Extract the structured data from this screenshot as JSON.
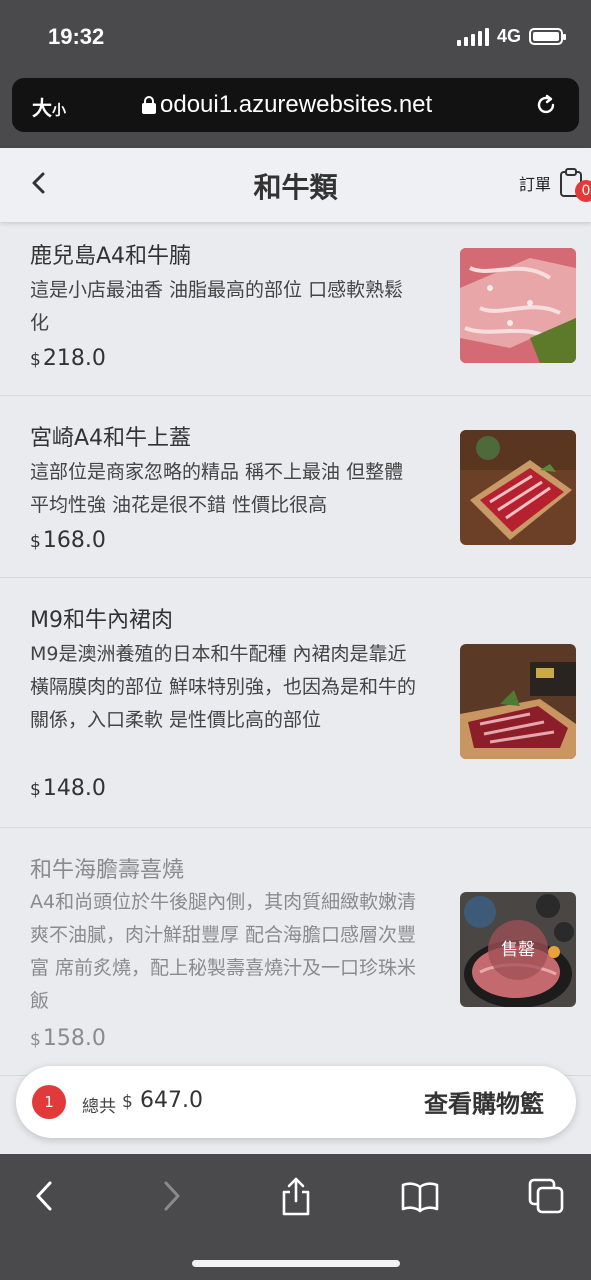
{
  "status_bar": {
    "time": "19:32",
    "network": "4G"
  },
  "browser": {
    "text_size_big": "大",
    "text_size_small": "小",
    "url": "odoui1.azurewebsites.net"
  },
  "header": {
    "title": "和牛類",
    "orders_label": "訂單",
    "orders_badge": "0"
  },
  "items": [
    {
      "name": "鹿兒島A4和牛腩",
      "desc": "這是小店最油香 油脂最高的部位 口感軟熟鬆化",
      "currency": "$",
      "price": "218.0"
    },
    {
      "name": "宮崎A4和牛上蓋",
      "desc": "這部位是商家忽略的精品 稱不上最油 但整體平均性強 油花是很不錯 性價比很高",
      "currency": "$",
      "price": "168.0"
    },
    {
      "name": "M9和牛內裙肉",
      "desc": "M9是澳洲養殖的日本和牛配種 內裙肉是靠近橫隔膜肉的部位 鮮味特別強，也因為是和牛的關係，入口柔軟 是性價比高的部位",
      "currency": "$",
      "price": "148.0"
    },
    {
      "name": "和牛海膽壽喜燒",
      "desc": "A4和尚頭位於牛後腿內側，其肉質細緻軟嫩清爽不油膩，肉汁鮮甜豐厚 配合海膽口感層次豐富 席前炙燒，配上秘製壽喜燒汁及一口珍珠米飯",
      "currency": "$",
      "price": "158.0",
      "badge": "售罄"
    }
  ],
  "cart": {
    "count": "1",
    "total_label": "總共",
    "currency": "$",
    "total": "647.0",
    "view_button": "查看購物籃"
  },
  "colors": {
    "accent_red": "#e23a3a",
    "background": "#e9ebef",
    "chrome": "#4a4a4d"
  }
}
